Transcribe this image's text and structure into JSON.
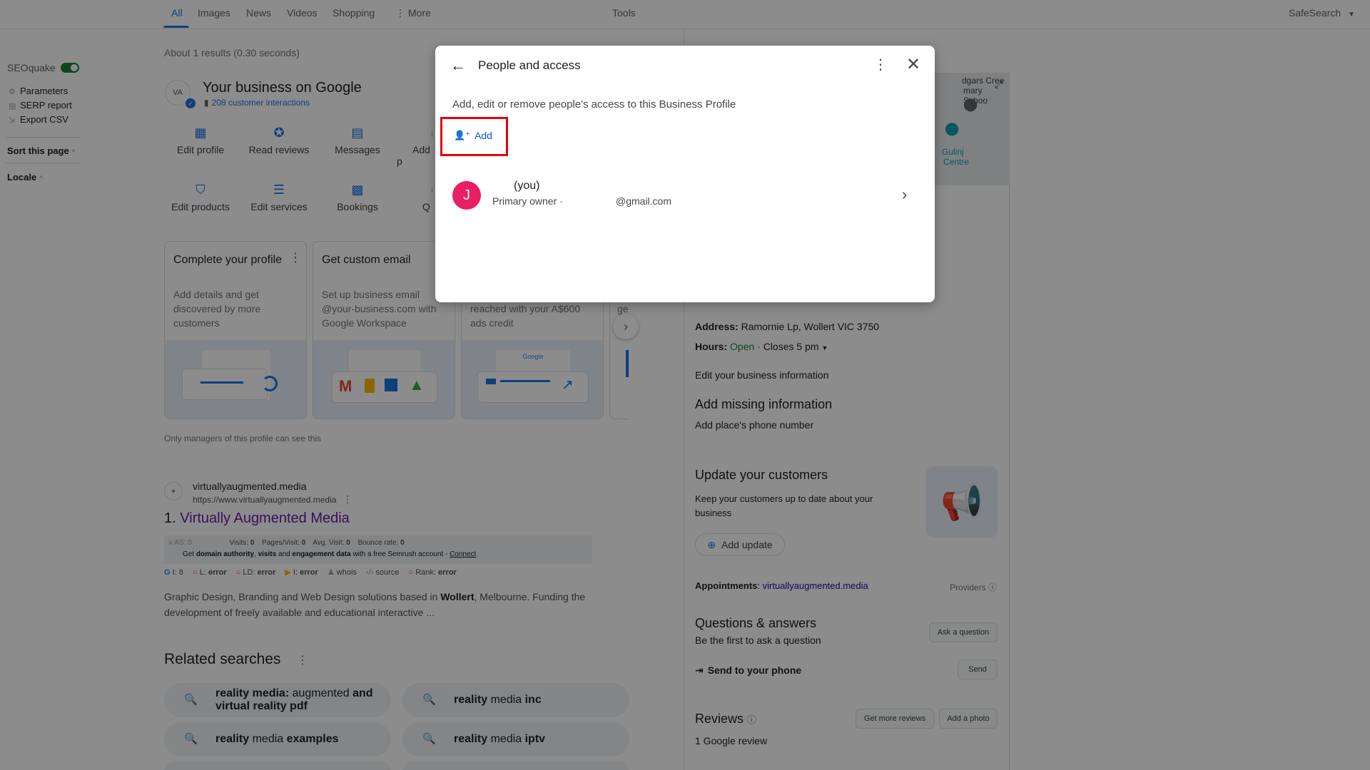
{
  "nav": {
    "tabs": [
      {
        "label": "All"
      },
      {
        "label": "Images"
      },
      {
        "label": "News"
      },
      {
        "label": "Videos"
      },
      {
        "label": "Shopping"
      },
      {
        "label": "More"
      }
    ],
    "tools": "Tools",
    "safesearch": "SafeSearch"
  },
  "seoquake": {
    "title": "SEOquake",
    "items": [
      "Parameters",
      "SERP report",
      "Export CSV"
    ],
    "sort": "Sort this page",
    "locale": "Locale"
  },
  "results_stats": "About 1 results (0.30 seconds)",
  "business": {
    "logo_text": "VA",
    "title": "Your business on Google",
    "interactions": "208 customer interactions",
    "actions_row1": [
      "Edit profile",
      "Read reviews",
      "Messages",
      "Add p"
    ],
    "actions_row2": [
      "Edit products",
      "Edit services",
      "Bookings",
      "Q"
    ],
    "cards": [
      {
        "title": "Complete your profile",
        "desc": "Add details and get discovered by more customers"
      },
      {
        "title": "Get custom email",
        "desc": "Set up business email @your-business.com with Google Workspace"
      },
      {
        "title": "",
        "desc": "reached with your A$600 ads credit"
      },
      {
        "title": "",
        "desc": "ge"
      }
    ],
    "managers_note": "Only managers of this profile can see this"
  },
  "result": {
    "site": "virtuallyaugmented.media",
    "url": "https://www.virtuallyaugmented.media",
    "number": "1.",
    "title": "Virtually Augmented Media",
    "seo_bar": {
      "as": "AS: 0",
      "visits": "Visits:",
      "visits_val": "0",
      "pages": "Pages/Visit:",
      "pages_val": "0",
      "avg": "Avg. Visit:",
      "avg_val": "0",
      "bounce": "Bounce rate:",
      "bounce_val": "0",
      "line2a": "Get ",
      "line2b": "domain authority",
      "line2c": ", ",
      "line2d": "visits",
      "line2e": " and ",
      "line2f": "engagement data",
      "line2g": " with a free Semrush account - ",
      "connect": "Connect"
    },
    "seo_row": {
      "g": "I: 8",
      "l": "L:",
      "l_val": "error",
      "ld": "LD:",
      "ld_val": "error",
      "i": "I:",
      "i_val": "error",
      "whois": "whois",
      "source": "source",
      "rank": "Rank:",
      "rank_val": "error"
    },
    "snippet_a": "Graphic Design, Branding and Web Design solutions based in ",
    "snippet_bold": "Wollert",
    "snippet_b": ", Melbourne. Funding the development of freely available and educational interactive ..."
  },
  "related": {
    "title": "Related searches",
    "items": [
      {
        "bold1": "reality media:",
        "normal": " augmented ",
        "bold2": "and virtual reality pdf"
      },
      {
        "bold1": "reality",
        "normal": " media ",
        "bold2": "inc"
      },
      {
        "bold1": "reality",
        "normal": " media ",
        "bold2": "examples"
      },
      {
        "bold1": "reality",
        "normal": " media ",
        "bold2": "iptv"
      }
    ]
  },
  "panel": {
    "map_labels": [
      "dgars Cree",
      "mary Schoo",
      "Gulinj",
      "Centre"
    ],
    "address_label": "Address:",
    "address": "Ramornie Lp, Wollert VIC 3750",
    "hours_label": "Hours:",
    "hours_open": "Open",
    "hours_close": "· Closes 5 pm",
    "edit_info": "Edit your business information",
    "missing_title": "Add missing information",
    "missing_phone": "Add place's phone number",
    "update_title": "Update your customers",
    "update_desc": "Keep your customers up to date about your business",
    "add_update": "Add update",
    "appointments_label": "Appointments",
    "appointments_link": "virtuallyaugmented.media",
    "providers": "Providers",
    "qa_title": "Questions & answers",
    "qa_first": "Be the first to ask a question",
    "ask": "Ask a question",
    "send_phone": "Send to your phone",
    "send": "Send",
    "reviews_title": "Reviews",
    "get_reviews": "Get more reviews",
    "add_photo": "Add a photo",
    "review_count": "1 Google review"
  },
  "dialog": {
    "title": "People and access",
    "description": "Add, edit or remove people's access to this Business Profile",
    "add_label": "Add",
    "person": {
      "initial": "J",
      "name": "(you)",
      "role": "Primary owner ·",
      "email": "@gmail.com"
    }
  },
  "colors": {
    "accent": "#1a73e8",
    "highlight_box": "#e8000b",
    "avatar": "#e91e63"
  }
}
